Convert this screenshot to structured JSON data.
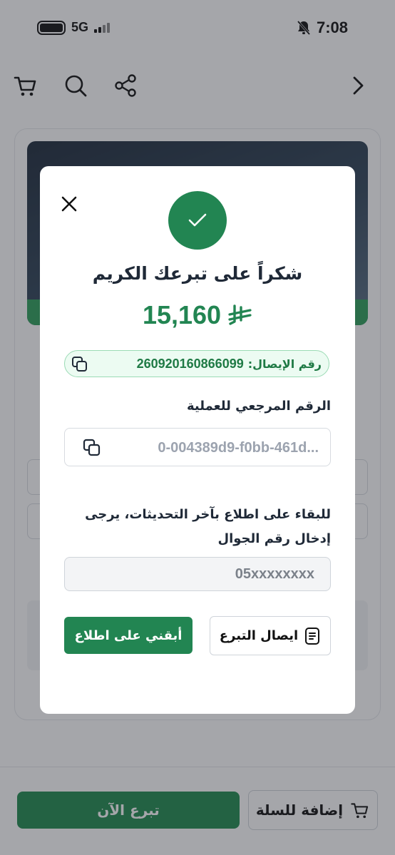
{
  "status_bar": {
    "network": "5G",
    "time": "7:08"
  },
  "background": {
    "donate_now_label": "تبرع الآن",
    "add_to_cart_label": "إضافة للسلة"
  },
  "modal": {
    "title": "شكراً على تبرعك الكريم",
    "amount": "15,160",
    "currency_icon": "riyal-icon",
    "receipt_number_label": "رقم الإيصال:",
    "receipt_number": "260920160866099",
    "reference_label": "الرقم المرجعي للعملية",
    "reference_value": "0-004389d9-f0bb-461d...",
    "phone_prompt": "للبقاء على اطلاع بآخر التحديثات، يرجى إدخال رقم الجوال",
    "phone_placeholder": "05xxxxxxxx",
    "keep_me_informed_label": "أبقني على اطلاع",
    "donation_receipt_label": "ايصال التبرع"
  },
  "colors": {
    "primary_green": "#228552",
    "overlay": "rgba(40,44,52,0.42)"
  }
}
